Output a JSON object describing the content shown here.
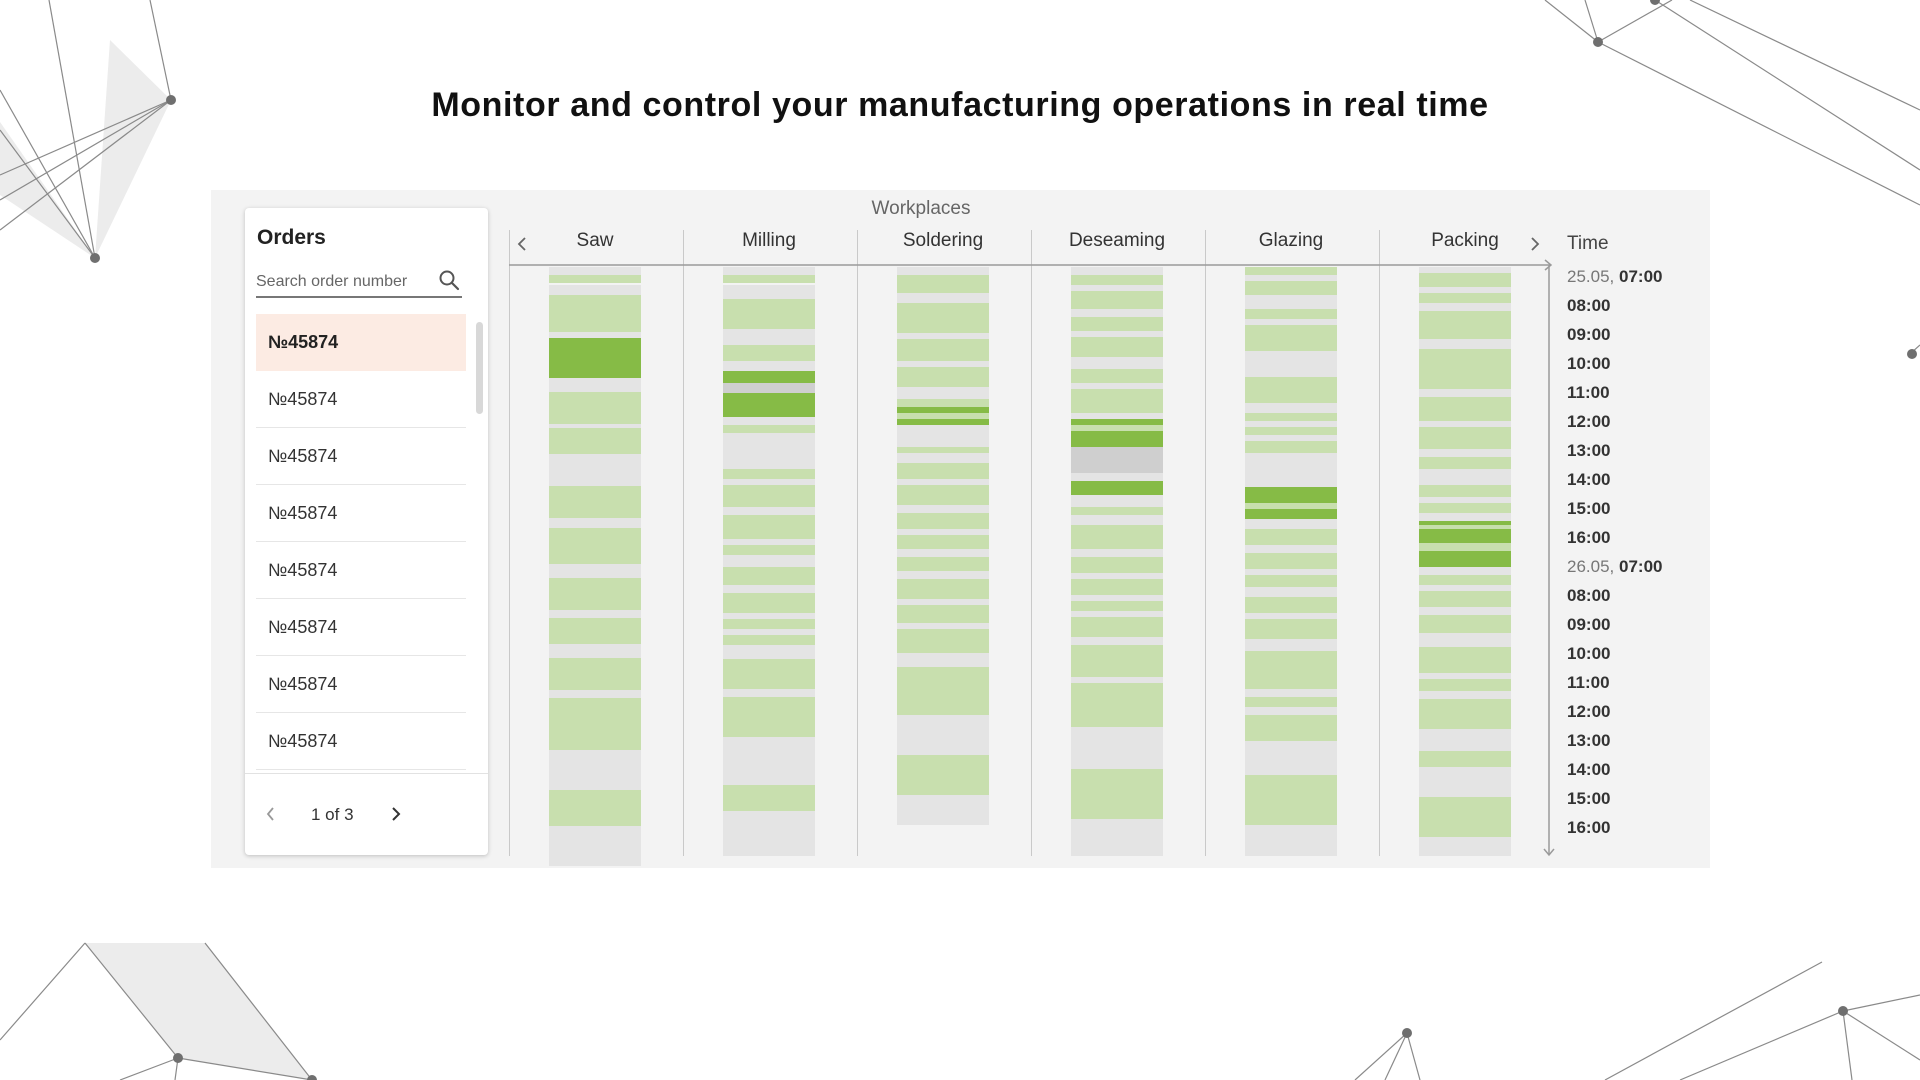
{
  "headline": "Monitor and control your manufacturing operations in real time",
  "orders_panel": {
    "title": "Orders",
    "search_placeholder": "Search order number",
    "search_icon": "search-icon",
    "items": [
      "№45874",
      "№45874",
      "№45874",
      "№45874",
      "№45874",
      "№45874",
      "№45874",
      "№45874"
    ],
    "selected_index": 0,
    "pagination": "1 of 3"
  },
  "schedule": {
    "title": "Workplaces",
    "workplaces": [
      "Saw",
      "Milling",
      "Soldering",
      "Deseaming",
      "Glazing",
      "Packing"
    ],
    "time_title": "Time",
    "time_labels": [
      {
        "date": "25.05,",
        "time": "07:00"
      },
      {
        "date": "",
        "time": "08:00"
      },
      {
        "date": "",
        "time": "09:00"
      },
      {
        "date": "",
        "time": "10:00"
      },
      {
        "date": "",
        "time": "11:00"
      },
      {
        "date": "",
        "time": "12:00"
      },
      {
        "date": "",
        "time": "13:00"
      },
      {
        "date": "",
        "time": "14:00"
      },
      {
        "date": "",
        "time": "15:00"
      },
      {
        "date": "",
        "time": "16:00"
      },
      {
        "date": "26.05,",
        "time": "07:00"
      },
      {
        "date": "",
        "time": "08:00"
      },
      {
        "date": "",
        "time": "09:00"
      },
      {
        "date": "",
        "time": "10:00"
      },
      {
        "date": "",
        "time": "11:00"
      },
      {
        "date": "",
        "time": "12:00"
      },
      {
        "date": "",
        "time": "13:00"
      },
      {
        "date": "",
        "time": "14:00"
      },
      {
        "date": "",
        "time": "15:00"
      },
      {
        "date": "",
        "time": "16:00"
      }
    ],
    "colors": {
      "planned": "#c8dfae",
      "active": "#86bb46",
      "idle": "#e4e4e4",
      "blocked": "#cfcfcf",
      "selected_order": "#fcebe3"
    }
  }
}
